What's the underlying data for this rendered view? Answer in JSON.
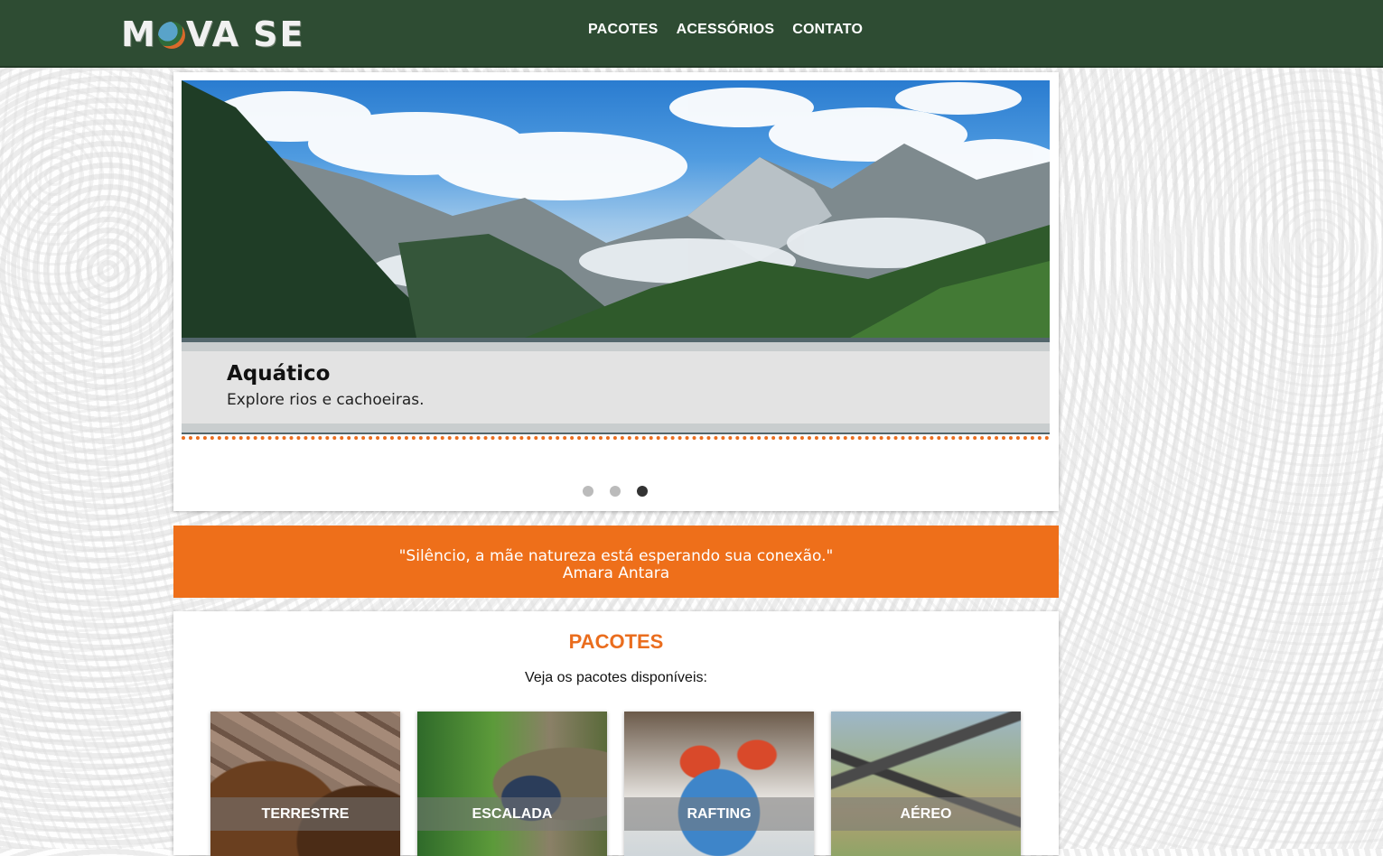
{
  "header": {
    "logo_text": "MOVA SE",
    "nav": [
      {
        "label": "PACOTES"
      },
      {
        "label": "ACESSÓRIOS"
      },
      {
        "label": "CONTATO"
      }
    ]
  },
  "carousel": {
    "caption_title": "Aquático",
    "caption_text": "Explore rios e cachoeiras.",
    "slide_count": 3,
    "active_index": 3
  },
  "quote": {
    "text": "\"Silêncio, a mãe natureza está esperando sua conexão.\"",
    "author": "Amara Antara"
  },
  "pacotes": {
    "title": "PACOTES",
    "subtitle": "Veja os pacotes disponíveis:",
    "items": [
      {
        "label": "TERRESTRE"
      },
      {
        "label": "ESCALADA"
      },
      {
        "label": "RAFTING"
      },
      {
        "label": "AÉREO"
      }
    ]
  },
  "colors": {
    "header_bg": "#2e4c33",
    "accent": "#ee6f1a"
  }
}
